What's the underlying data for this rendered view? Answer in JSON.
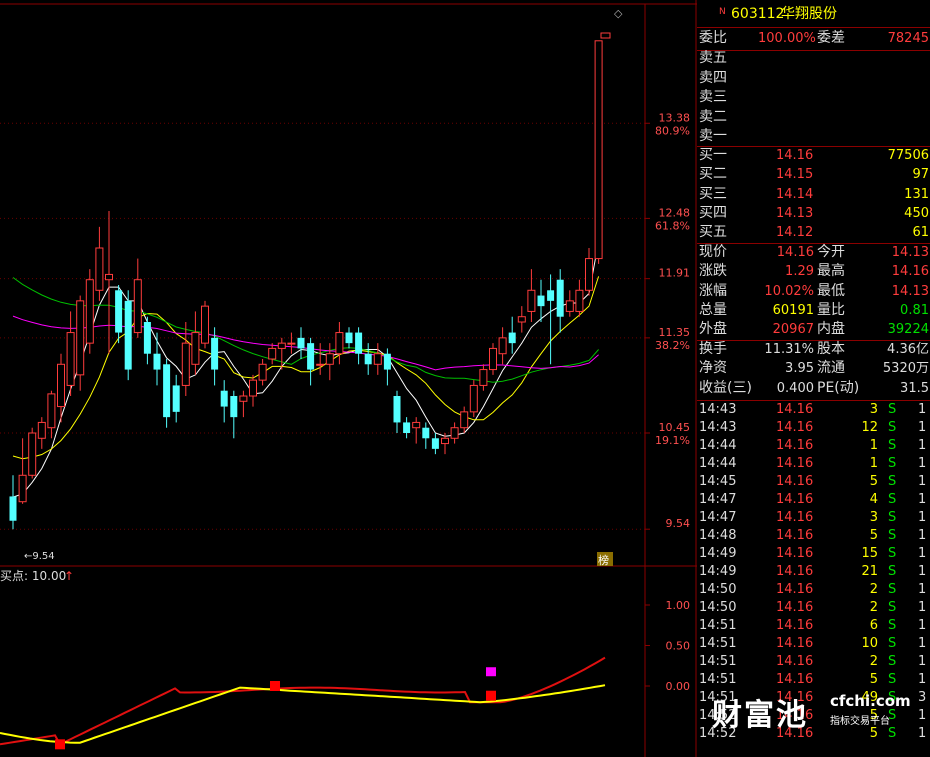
{
  "stock": {
    "marker": "N",
    "code": "603112",
    "name": "华翔股份"
  },
  "order_ratio": {
    "label1": "委比",
    "value1": "100.00%",
    "label2": "委差",
    "value2": "78245"
  },
  "asks": [
    {
      "label": "卖五",
      "price": "",
      "vol": ""
    },
    {
      "label": "卖四",
      "price": "",
      "vol": ""
    },
    {
      "label": "卖三",
      "price": "",
      "vol": ""
    },
    {
      "label": "卖二",
      "price": "",
      "vol": ""
    },
    {
      "label": "卖一",
      "price": "",
      "vol": ""
    }
  ],
  "bids": [
    {
      "label": "买一",
      "price": "14.16",
      "vol": "77506"
    },
    {
      "label": "买二",
      "price": "14.15",
      "vol": "97"
    },
    {
      "label": "买三",
      "price": "14.14",
      "vol": "131"
    },
    {
      "label": "买四",
      "price": "14.13",
      "vol": "450"
    },
    {
      "label": "买五",
      "price": "14.12",
      "vol": "61"
    }
  ],
  "quote": [
    {
      "l1": "现价",
      "v1": "14.16",
      "l2": "今开",
      "v2": "14.13"
    },
    {
      "l1": "涨跌",
      "v1": "1.29",
      "l2": "最高",
      "v2": "14.16"
    },
    {
      "l1": "涨幅",
      "v1": "10.02%",
      "l2": "最低",
      "v2": "14.13"
    },
    {
      "l1": "总量",
      "v1": "60191",
      "l2": "量比",
      "v2": "0.81"
    },
    {
      "l1": "外盘",
      "v1": "20967",
      "l2": "内盘",
      "v2": "39224"
    }
  ],
  "fundamentals": [
    {
      "l1": "换手",
      "v1": "11.31%",
      "l2": "股本",
      "v2": "4.36亿"
    },
    {
      "l1": "净资",
      "v1": "3.95",
      "l2": "流通",
      "v2": "5320万"
    },
    {
      "l1": "收益(三)",
      "v1": "0.400",
      "l2": "PE(动)",
      "v2": "31.5"
    }
  ],
  "ticks": [
    {
      "t": "14:43",
      "p": "14.16",
      "v": "3",
      "s": "S",
      "n": "1"
    },
    {
      "t": "14:43",
      "p": "14.16",
      "v": "12",
      "s": "S",
      "n": "1"
    },
    {
      "t": "14:44",
      "p": "14.16",
      "v": "1",
      "s": "S",
      "n": "1"
    },
    {
      "t": "14:44",
      "p": "14.16",
      "v": "1",
      "s": "S",
      "n": "1"
    },
    {
      "t": "14:45",
      "p": "14.16",
      "v": "5",
      "s": "S",
      "n": "1"
    },
    {
      "t": "14:47",
      "p": "14.16",
      "v": "4",
      "s": "S",
      "n": "1"
    },
    {
      "t": "14:47",
      "p": "14.16",
      "v": "3",
      "s": "S",
      "n": "1"
    },
    {
      "t": "14:48",
      "p": "14.16",
      "v": "5",
      "s": "S",
      "n": "1"
    },
    {
      "t": "14:49",
      "p": "14.16",
      "v": "15",
      "s": "S",
      "n": "1"
    },
    {
      "t": "14:49",
      "p": "14.16",
      "v": "21",
      "s": "S",
      "n": "1"
    },
    {
      "t": "14:50",
      "p": "14.16",
      "v": "2",
      "s": "S",
      "n": "1"
    },
    {
      "t": "14:50",
      "p": "14.16",
      "v": "2",
      "s": "S",
      "n": "1"
    },
    {
      "t": "14:51",
      "p": "14.16",
      "v": "6",
      "s": "S",
      "n": "1"
    },
    {
      "t": "14:51",
      "p": "14.16",
      "v": "10",
      "s": "S",
      "n": "1"
    },
    {
      "t": "14:51",
      "p": "14.16",
      "v": "2",
      "s": "S",
      "n": "1"
    },
    {
      "t": "14:51",
      "p": "14.16",
      "v": "5",
      "s": "S",
      "n": "1"
    },
    {
      "t": "14:51",
      "p": "14.16",
      "v": "49",
      "s": "S",
      "n": "3"
    },
    {
      "t": "14:52",
      "p": "14.16",
      "v": "5",
      "s": "S",
      "n": "1"
    },
    {
      "t": "14:52",
      "p": "14.16",
      "v": "5",
      "s": "S",
      "n": "1"
    }
  ],
  "indicator": {
    "label": "买点: 10.00",
    "arrow": "↑"
  },
  "badge": "榜",
  "watermark": {
    "big": "财富池",
    "domain": "cfchi.com",
    "sub": "指标交易平台"
  },
  "colors": {
    "up": "#ff3c3c",
    "down": "#54ffff",
    "ma5": "#ffffff",
    "ma10": "#ffff00",
    "ma20": "#00c000",
    "ma60": "#ff00ff",
    "grid": "#8b0000"
  },
  "chart_data": {
    "type": "candlestick",
    "y_axis_labels": [
      {
        "price": "13.38",
        "pct": "80.9%"
      },
      {
        "price": "12.48",
        "pct": "61.8%"
      },
      {
        "price": "11.91",
        "pct": ""
      },
      {
        "price": "11.35",
        "pct": "38.2%"
      },
      {
        "price": "10.45",
        "pct": "19.1%"
      },
      {
        "price": "9.54",
        "pct": ""
      }
    ],
    "low_marker": "9.54",
    "ylim": [
      9.54,
      14.16
    ],
    "candles": [
      [
        9.85,
        9.62,
        9.54,
        10.05
      ],
      [
        9.8,
        10.05,
        9.78,
        10.4
      ],
      [
        10.05,
        10.45,
        10.02,
        10.5
      ],
      [
        10.4,
        10.55,
        10.3,
        10.6
      ],
      [
        10.5,
        10.82,
        10.4,
        10.85
      ],
      [
        10.7,
        11.1,
        10.55,
        11.2
      ],
      [
        10.9,
        11.4,
        10.8,
        11.6
      ],
      [
        11.0,
        11.7,
        10.85,
        11.75
      ],
      [
        11.3,
        11.9,
        11.2,
        12.0
      ],
      [
        11.8,
        12.2,
        11.7,
        12.4
      ],
      [
        11.9,
        11.95,
        11.2,
        12.55
      ],
      [
        11.8,
        11.4,
        11.3,
        11.85
      ],
      [
        11.7,
        11.05,
        10.95,
        11.8
      ],
      [
        11.4,
        11.9,
        11.35,
        12.1
      ],
      [
        11.5,
        11.2,
        11.1,
        11.55
      ],
      [
        11.2,
        11.05,
        10.9,
        11.4
      ],
      [
        11.1,
        10.6,
        10.5,
        11.15
      ],
      [
        10.9,
        10.65,
        10.55,
        11.0
      ],
      [
        10.9,
        11.3,
        10.8,
        11.5
      ],
      [
        11.1,
        11.4,
        11.0,
        11.6
      ],
      [
        11.3,
        11.65,
        11.25,
        11.7
      ],
      [
        11.35,
        11.05,
        10.9,
        11.45
      ],
      [
        10.85,
        10.7,
        10.55,
        10.95
      ],
      [
        10.8,
        10.6,
        10.4,
        10.85
      ],
      [
        10.75,
        10.8,
        10.6,
        10.85
      ],
      [
        10.8,
        10.95,
        10.7,
        11.0
      ],
      [
        10.95,
        11.1,
        10.9,
        11.15
      ],
      [
        11.15,
        11.25,
        11.1,
        11.3
      ],
      [
        11.25,
        11.3,
        11.05,
        11.35
      ],
      [
        11.3,
        11.3,
        11.2,
        11.4
      ],
      [
        11.35,
        11.25,
        11.15,
        11.45
      ],
      [
        11.3,
        11.05,
        10.9,
        11.35
      ],
      [
        11.1,
        11.1,
        11.0,
        11.3
      ],
      [
        11.1,
        11.2,
        10.95,
        11.3
      ],
      [
        11.2,
        11.4,
        11.1,
        11.5
      ],
      [
        11.4,
        11.3,
        11.25,
        11.45
      ],
      [
        11.4,
        11.2,
        11.1,
        11.45
      ],
      [
        11.2,
        11.1,
        11.0,
        11.3
      ],
      [
        11.1,
        11.2,
        11.0,
        11.3
      ],
      [
        11.2,
        11.05,
        10.9,
        11.25
      ],
      [
        10.8,
        10.55,
        10.45,
        10.85
      ],
      [
        10.55,
        10.45,
        10.4,
        10.6
      ],
      [
        10.5,
        10.55,
        10.35,
        10.6
      ],
      [
        10.5,
        10.4,
        10.3,
        10.55
      ],
      [
        10.4,
        10.3,
        10.25,
        10.45
      ],
      [
        10.35,
        10.4,
        10.25,
        10.45
      ],
      [
        10.4,
        10.5,
        10.35,
        10.55
      ],
      [
        10.5,
        10.65,
        10.45,
        10.7
      ],
      [
        10.65,
        10.9,
        10.6,
        10.95
      ],
      [
        10.9,
        11.05,
        10.85,
        11.1
      ],
      [
        11.05,
        11.25,
        11.0,
        11.3
      ],
      [
        11.2,
        11.35,
        11.1,
        11.45
      ],
      [
        11.4,
        11.3,
        11.2,
        11.55
      ],
      [
        11.5,
        11.55,
        11.4,
        11.65
      ],
      [
        11.6,
        11.8,
        11.5,
        12.0
      ],
      [
        11.75,
        11.65,
        11.5,
        11.9
      ],
      [
        11.8,
        11.7,
        11.1,
        11.95
      ],
      [
        11.9,
        11.55,
        11.4,
        12.0
      ],
      [
        11.6,
        11.7,
        11.55,
        11.8
      ],
      [
        11.6,
        11.8,
        11.55,
        11.9
      ],
      [
        11.8,
        12.1,
        11.75,
        12.2
      ],
      [
        12.1,
        14.16,
        12.05,
        14.16
      ]
    ],
    "indicator_axis": [
      "1.00",
      "0.50",
      "0.00"
    ]
  }
}
